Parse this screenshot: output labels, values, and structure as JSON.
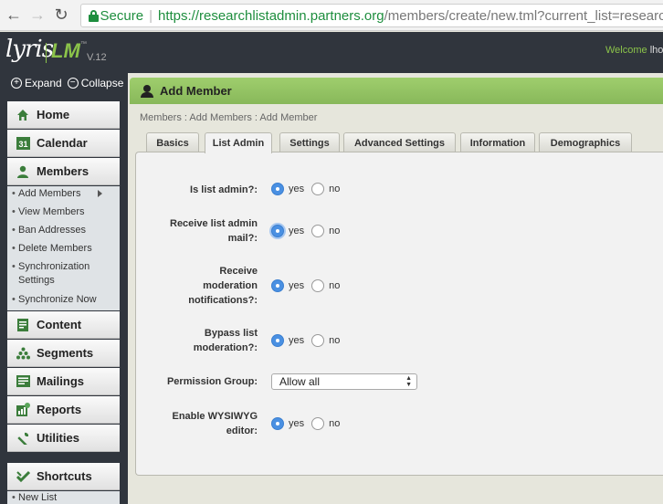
{
  "browser": {
    "secure_label": "Secure",
    "url_scheme_host": "https://researchlistadmin.partners.org",
    "url_path": "/members/create/new.tml?current_list=research"
  },
  "header": {
    "logo_text": "lyris",
    "logo_lm": "LM",
    "logo_tm": "™",
    "version": "V.12",
    "welcome_label": "Welcome",
    "welcome_user": "lho"
  },
  "sidebar": {
    "expand_label": "Expand",
    "collapse_label": "Collapse",
    "items": [
      {
        "label": "Home",
        "icon": "home-icon"
      },
      {
        "label": "Calendar",
        "icon": "calendar-icon",
        "badge": "31"
      },
      {
        "label": "Members",
        "icon": "members-icon"
      },
      {
        "label": "Content",
        "icon": "content-icon"
      },
      {
        "label": "Segments",
        "icon": "segments-icon"
      },
      {
        "label": "Mailings",
        "icon": "mailings-icon"
      },
      {
        "label": "Reports",
        "icon": "reports-icon"
      },
      {
        "label": "Utilities",
        "icon": "utilities-icon"
      },
      {
        "label": "Shortcuts",
        "icon": "shortcuts-icon"
      }
    ],
    "members_sub": [
      "Add Members",
      "View Members",
      "Ban Addresses",
      "Delete Members",
      "Synchronization Settings",
      "Synchronize Now"
    ],
    "shortcuts_sub": [
      "New List"
    ]
  },
  "main": {
    "title": "Add Member",
    "breadcrumb": "Members : Add Members : Add Member",
    "tabs": [
      "Basics",
      "List Admin",
      "Settings",
      "Advanced Settings",
      "Information",
      "Demographics"
    ],
    "active_tab": "List Admin",
    "yes_label": "yes",
    "no_label": "no",
    "fields": [
      {
        "label": "Is list admin?:",
        "value": "yes"
      },
      {
        "label": "Receive list admin mail?:",
        "value": "yes"
      },
      {
        "label": "Receive moderation notifications?:",
        "value": "yes"
      },
      {
        "label": "Bypass list moderation?:",
        "value": "yes"
      },
      {
        "label": "Permission Group:",
        "value": "Allow all"
      },
      {
        "label": "Enable WYSIWYG editor:",
        "value": "yes"
      }
    ]
  }
}
